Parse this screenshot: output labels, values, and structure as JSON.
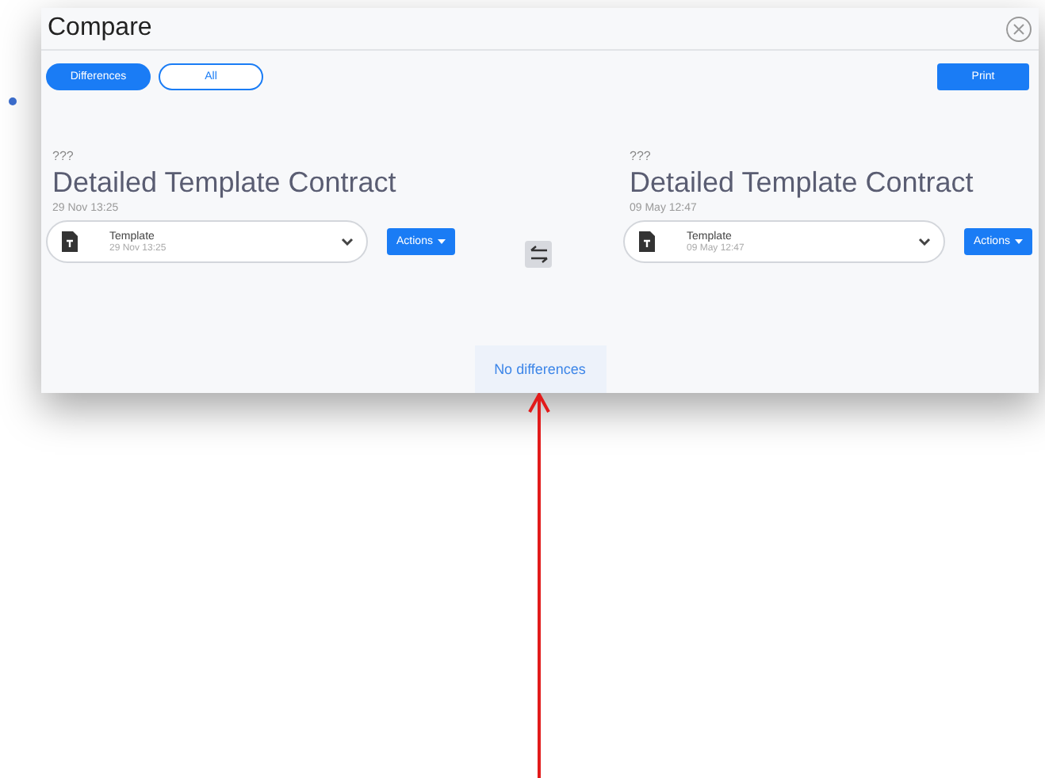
{
  "window": {
    "title": "Compare"
  },
  "filters": [
    {
      "label": "Differences",
      "selected": true
    },
    {
      "label": "All",
      "selected": false
    }
  ],
  "print_button": "Print",
  "versions": [
    {
      "label": "???",
      "name": "Detailed Template Contract",
      "date": "29 Nov 13:25",
      "file": {
        "name": "Template",
        "date": "29 Nov 13:25"
      },
      "actions": "Actions"
    },
    {
      "label": "???",
      "name": "Detailed Template Contract",
      "date": "09 May 12:47",
      "file": {
        "name": "Template",
        "date": "09 May 12:47"
      },
      "actions": "Actions"
    }
  ],
  "message": "No differences"
}
